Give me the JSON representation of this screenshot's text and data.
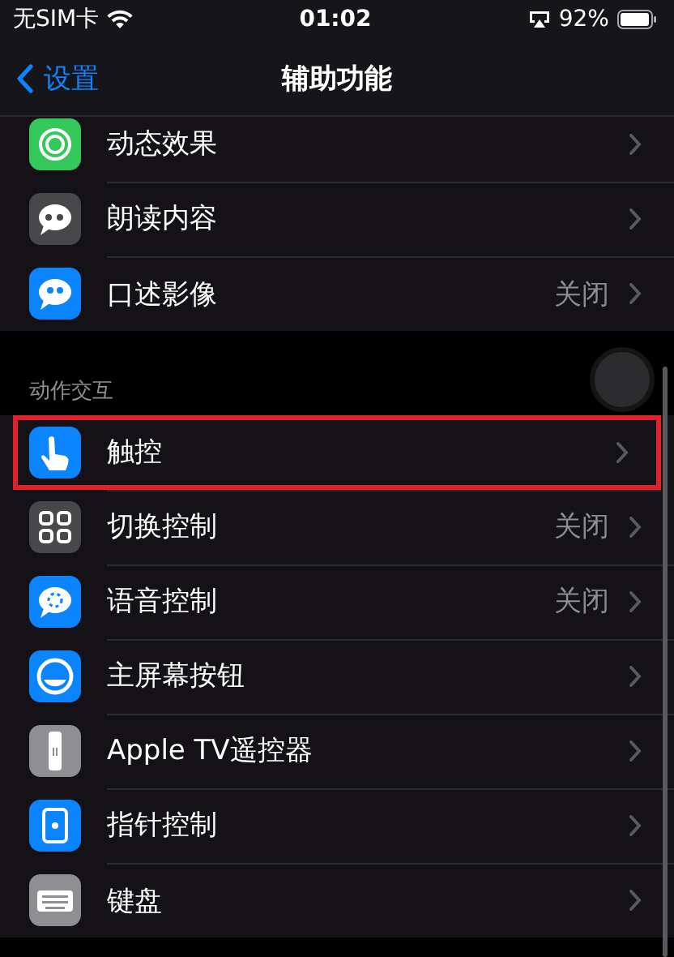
{
  "status_bar": {
    "carrier": "无SIM卡",
    "time": "01:02",
    "battery": "92%"
  },
  "nav": {
    "back": "设置",
    "title": "辅助功能"
  },
  "groups": [
    {
      "items": [
        {
          "label": "动态效果",
          "color": "#34c759",
          "highlighted": false
        },
        {
          "label": "朗读内容",
          "color": "#48484a",
          "highlighted": false
        },
        {
          "label": "口述影像",
          "value": "关闭",
          "color": "#0a84ff",
          "highlighted": false
        }
      ]
    },
    {
      "header": "动作交互",
      "items": [
        {
          "label": "触控",
          "color": "#0a84ff",
          "highlighted": true
        },
        {
          "label": "切换控制",
          "value": "关闭",
          "color": "#48484a",
          "highlighted": false
        },
        {
          "label": "语音控制",
          "value": "关闭",
          "color": "#0a84ff",
          "highlighted": false
        },
        {
          "label": "主屏幕按钮",
          "color": "#0a84ff",
          "highlighted": false
        },
        {
          "label": "Apple TV遥控器",
          "color": "#8e8e93",
          "highlighted": false
        },
        {
          "label": "指针控制",
          "color": "#0a84ff",
          "highlighted": false
        },
        {
          "label": "键盘",
          "color": "#8e8e93",
          "highlighted": false
        }
      ]
    }
  ]
}
